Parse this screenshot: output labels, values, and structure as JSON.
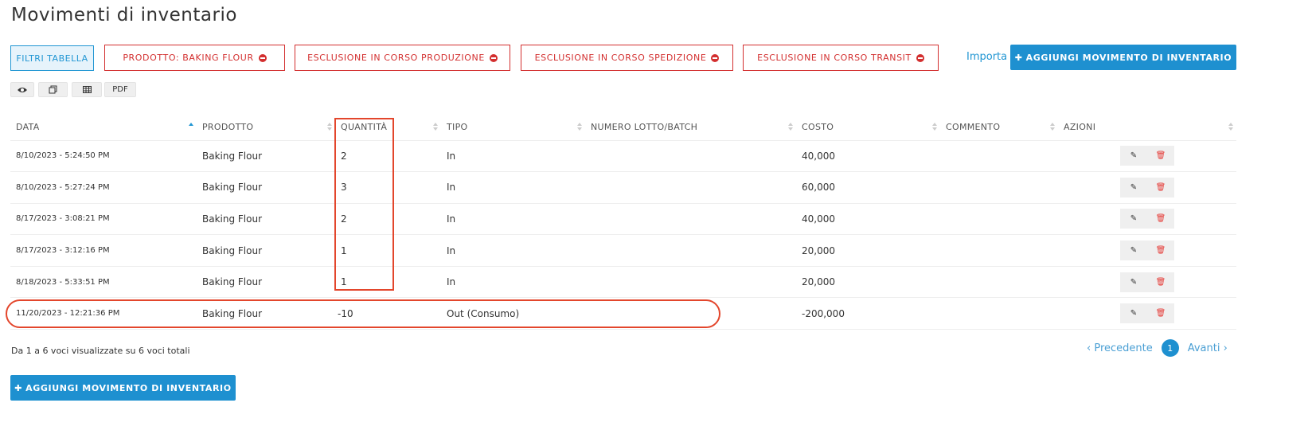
{
  "page": {
    "title": "Movimenti di inventario"
  },
  "filters": {
    "table_filters_label": "FILTRI TABELLA",
    "chips": [
      "PRODOTTO: BAKING FLOUR",
      "ESCLUSIONE IN CORSO PRODUZIONE",
      "ESCLUSIONE IN CORSO SPEDIZIONE",
      "ESCLUSIONE IN CORSO TRANSIT"
    ]
  },
  "toolbar": {
    "import_label": "Importa",
    "add_label": "AGGIUNGI MOVIMENTO DI INVENTARIO",
    "pdf_label": "PDF"
  },
  "table": {
    "columns": [
      "DATA",
      "PRODOTTO",
      "QUANTITÀ",
      "TIPO",
      "NUMERO LOTTO/BATCH",
      "COSTO",
      "COMMENTO",
      "AZIONI"
    ],
    "rows": [
      {
        "date": "8/10/2023 - 5:24:50 PM",
        "product": "Baking Flour",
        "qty": "2",
        "type": "In",
        "lot": "",
        "cost": "40,000",
        "comment": ""
      },
      {
        "date": "8/10/2023 - 5:27:24 PM",
        "product": "Baking Flour",
        "qty": "3",
        "type": "In",
        "lot": "",
        "cost": "60,000",
        "comment": ""
      },
      {
        "date": "8/17/2023 - 3:08:21 PM",
        "product": "Baking Flour",
        "qty": "2",
        "type": "In",
        "lot": "",
        "cost": "40,000",
        "comment": ""
      },
      {
        "date": "8/17/2023 - 3:12:16 PM",
        "product": "Baking Flour",
        "qty": "1",
        "type": "In",
        "lot": "",
        "cost": "20,000",
        "comment": ""
      },
      {
        "date": "8/18/2023 - 5:33:51 PM",
        "product": "Baking Flour",
        "qty": "1",
        "type": "In",
        "lot": "",
        "cost": "20,000",
        "comment": ""
      },
      {
        "date": "11/20/2023 - 12:21:36 PM",
        "product": "Baking Flour",
        "qty": "-10",
        "type": "Out (Consumo)",
        "lot": "",
        "cost": "-200,000",
        "comment": ""
      }
    ]
  },
  "footer": {
    "info": "Da 1 a 6 voci visualizzate su 6 voci totali",
    "prev": "‹ Precedente",
    "page": "1",
    "next": "Avanti ›",
    "add_label": "AGGIUNGI MOVIMENTO DI INVENTARIO"
  },
  "colors": {
    "accent": "#1e90d0",
    "danger": "#d32f2f",
    "highlight": "#e3462c"
  }
}
